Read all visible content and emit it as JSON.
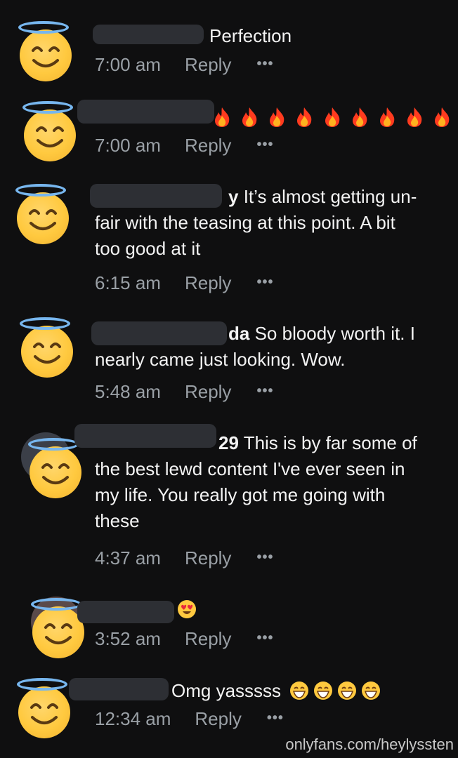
{
  "comments": [
    {
      "name_visible": "",
      "text_bold": "",
      "text": "Perfection",
      "time": "7:00 am",
      "reply": "Reply",
      "more": "•••"
    },
    {
      "name_visible": "",
      "text_bold": "",
      "text": "",
      "emojis": [
        "fire",
        "fire",
        "fire",
        "fire",
        "fire",
        "fire",
        "fire",
        "fire",
        "fire"
      ],
      "time": "7:00 am",
      "reply": "Reply",
      "more": "•••"
    },
    {
      "name_visible": "y",
      "text_bold": "y",
      "text_line1": "It’s almost getting un-",
      "text_line2": "fair with the teasing at this point. A bit",
      "text_line3": "too good at it",
      "time": "6:15 am",
      "reply": "Reply",
      "more": "•••"
    },
    {
      "text_bold": "da",
      "text_line1": "So bloody worth it. I",
      "text_line2": "nearly came just looking. Wow.",
      "time": "5:48 am",
      "reply": "Reply",
      "more": "•••"
    },
    {
      "text_bold": "29",
      "text_line1": "This is by far some of",
      "text_line2": "the best lewd content I've ever seen in",
      "text_line3": "my life. You really got me going with",
      "text_line4": "these",
      "time": "4:37 am",
      "reply": "Reply",
      "more": "•••"
    },
    {
      "text": "",
      "emojis": [
        "heart-eyes"
      ],
      "time": "3:52 am",
      "reply": "Reply",
      "more": "•••"
    },
    {
      "text": "Omg yasssss",
      "emojis": [
        "grin",
        "grin",
        "grin",
        "grin"
      ],
      "time": "12:34 am",
      "reply": "Reply",
      "more": "•••"
    }
  ],
  "watermark": "onlyfans.com/heylyssten",
  "colors": {
    "background": "#0f0f10",
    "meta": "#9aa0a6",
    "halo": "#77b6ee",
    "face": "#ffc93f"
  }
}
